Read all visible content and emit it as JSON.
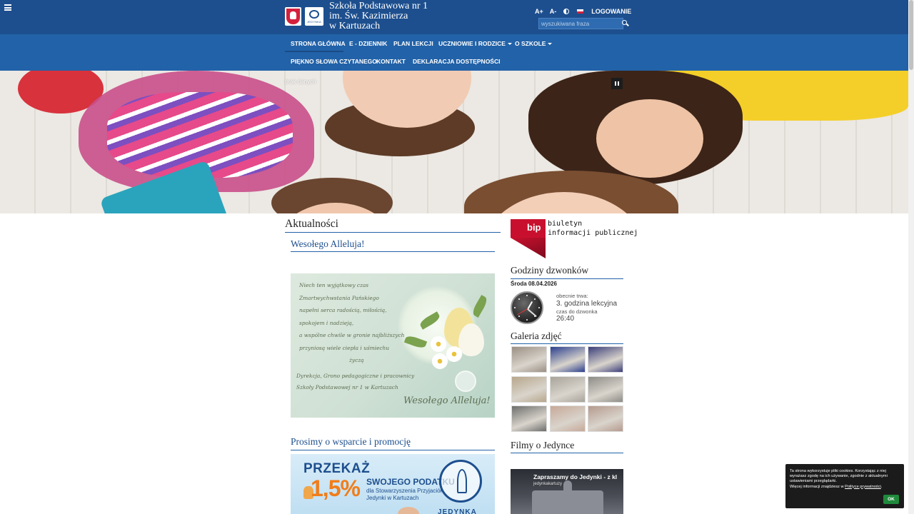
{
  "header": {
    "title_lines": [
      "Szkoła Podstawowa nr 1",
      "im. Św. Kazimierza",
      "w Kartuzach"
    ],
    "school_logo_text": "JEDYNKA",
    "font_increase": "A+",
    "font_decrease": "A-",
    "login": "LOGOWANIE",
    "search_placeholder": "wyszukiwana fraza"
  },
  "nav": {
    "row1": [
      {
        "label": "STRONA GŁÓWNA",
        "dropdown": false,
        "active": true
      },
      {
        "label": "E - DZIENNIK",
        "dropdown": false
      },
      {
        "label": "PLAN LEKCJI",
        "dropdown": false
      },
      {
        "label": "UCZNIOWIE I RODZICE",
        "dropdown": true
      },
      {
        "label": "O SZKOLE",
        "dropdown": true
      }
    ],
    "row2": [
      {
        "label": "PIĘKNO SŁOWA CZYTANEGO"
      },
      {
        "label": "KONTAKT"
      },
      {
        "label": "DEKLARACJA DOSTĘPNOŚCI"
      }
    ]
  },
  "hero": {
    "caption": "brak danych"
  },
  "news": {
    "heading": "Aktualności",
    "article1": {
      "title": "Wesołego Alleluja!",
      "card_lines": [
        "Niech ten wyjątkowy czas",
        "Zmartwychwstania Pańskiego",
        "napełni serca radością, miłością,",
        "spokojem i nadzieją,",
        "a wspólne chwile w gronie najbliższych",
        "przyniosą wiele ciepła i uśmiechu",
        "życzą"
      ],
      "card_sign": [
        "Dyrekcja, Grono pedagogiczne i pracownicy",
        "Szkoły Podstawowej nr 1 w Kartuzach"
      ],
      "card_greeting": "Wesołego Alleluja!"
    },
    "article2": {
      "title": "Prosimy o wsparcie i promocję",
      "banner_line1": "PRZEKAŻ",
      "banner_percent": "1,5%",
      "banner_line2": "SWOJEGO PODATKU",
      "banner_line3": "dla Stowarzyszenia Przyjaciół",
      "banner_line4": "Jedynki w Kartuzach",
      "banner_logo": "JEDYNKA"
    }
  },
  "sidebar": {
    "bip_word": "bip",
    "bip_line1": "biuletyn",
    "bip_line2": "informacji publicznej",
    "bells": {
      "title": "Godziny dzwonków",
      "date": "Środa 08.04.2026",
      "current_label": "obecnie trwa:",
      "current_value": "3. godzina lekcyjna",
      "remaining_label": "czas do dzwonka",
      "remaining_value": "26:40"
    },
    "gallery": {
      "title": "Galeria zdjęć",
      "thumb_colors": [
        "#9b8f84",
        "#2b3f8e",
        "#3b3e7a",
        "#b7a78c",
        "#a8a49a",
        "#8d8c86",
        "#6d6e6c",
        "#c7a898",
        "#b59a8e"
      ]
    },
    "films": {
      "title": "Filmy o Jedynce",
      "video_title": "Zapraszamy do Jedynki - z kl",
      "video_channel": "jedynkakartuzy"
    }
  },
  "cookie": {
    "text": "Ta strona wykorzystuje pliki cookies. Korzystając z niej wyrażasz zgodę na ich używanie, zgodnie z aktualnymi ustawieniami przeglądarki.",
    "more_prefix": "Więcej informacji znajdziesz w ",
    "more_link": "Polityce prywatności",
    "ok": "OK"
  },
  "colors": {
    "header_bg": "#1d4f8e",
    "nav_bg": "#2262a8",
    "link_blue": "#1d4f8e",
    "bip_red": "#c8102e",
    "ok_green": "#1f8a3c"
  }
}
